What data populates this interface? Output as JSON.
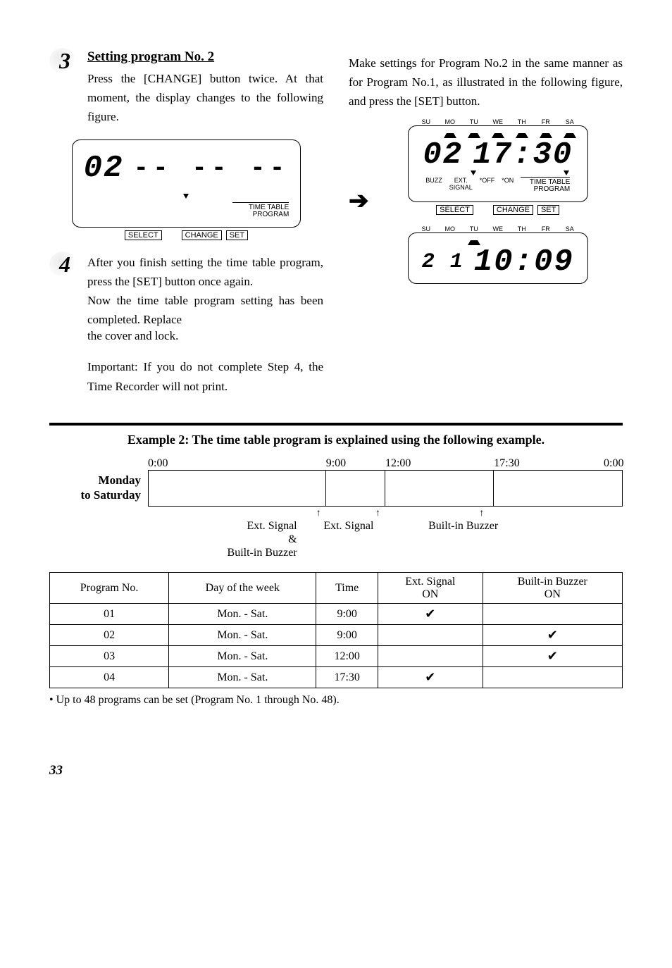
{
  "steps": {
    "s3": {
      "num": "3",
      "title": "Setting program No. 2",
      "body_left": "Press the [CHANGE] button twice. At that moment, the display changes to the following figure.",
      "body_right": "Make settings for Program No.2 in the same manner as for Program No.1, as illustrated in the following figure, and press the [SET] button."
    },
    "s4": {
      "num": "4",
      "body1": "After you finish setting the time table program, press the [SET] button once again.",
      "body2": "Now the time table program setting has been completed. Replace",
      "body3": "the cover and lock.",
      "important": "Important: If you do not complete Step 4, the Time Recorder will  not print."
    }
  },
  "days": [
    "SU",
    "MO",
    "TU",
    "WE",
    "TH",
    "FR",
    "SA"
  ],
  "lcd": {
    "fig_a": {
      "prog": "02",
      "time": "-- -- --"
    },
    "fig_b": {
      "prog": "02",
      "time": "17:30"
    },
    "fig_c": {
      "prog": "2 1",
      "time": "10:09"
    },
    "labels": {
      "buzz": "BUZZ",
      "ext": "EXT.\nSIGNAL",
      "off": "*OFF",
      "on": "*ON",
      "tt": "TIME TABLE",
      "prog": "PROGRAM"
    },
    "buttons": {
      "select": "SELECT",
      "change": "CHANGE",
      "set": "SET"
    }
  },
  "example": {
    "title": "Example 2: The time table program is explained using the following example.",
    "row_label": "Monday\nto Saturday",
    "times": [
      "0:00",
      "9:00",
      "12:00",
      "17:30",
      "0:00"
    ],
    "events": [
      "Ext. Signal\n&\nBuilt-in Buzzer",
      "Ext. Signal",
      "Built-in Buzzer"
    ]
  },
  "table": {
    "headers": [
      "Program No.",
      "Day of the week",
      "Time",
      "Ext. Signal\nON",
      "Built-in Buzzer\nON"
    ],
    "rows": [
      {
        "no": "01",
        "day": "Mon. - Sat.",
        "time": "9:00",
        "ext": true,
        "buzz": false
      },
      {
        "no": "02",
        "day": "Mon. - Sat.",
        "time": "9:00",
        "ext": false,
        "buzz": true
      },
      {
        "no": "03",
        "day": "Mon. - Sat.",
        "time": "12:00",
        "ext": false,
        "buzz": true
      },
      {
        "no": "04",
        "day": "Mon. - Sat.",
        "time": "17:30",
        "ext": true,
        "buzz": false
      }
    ]
  },
  "footnote": "• Up to 48 programs can be set (Program No. 1 through No. 48).",
  "page": "33"
}
